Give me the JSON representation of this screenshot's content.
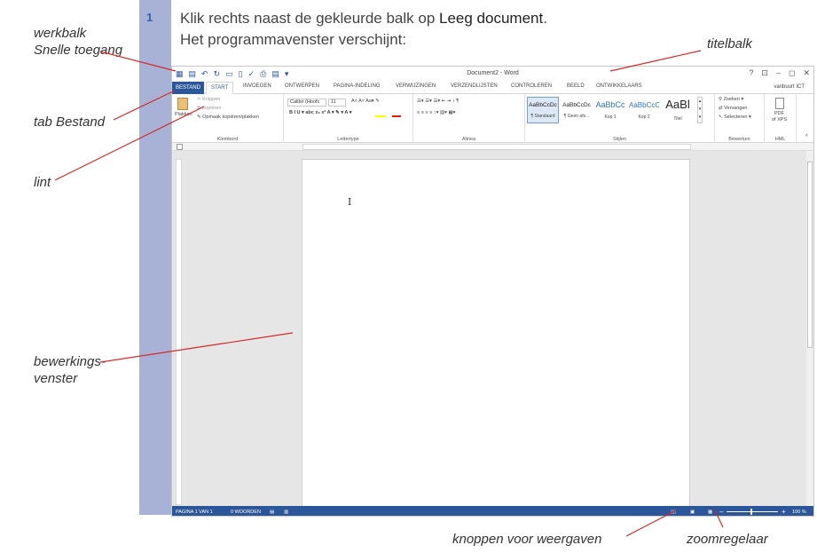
{
  "step_number": "1",
  "instruction": {
    "line1_prefix": "Klik rechts naast de gekleurde balk op ",
    "line1_bold": "Leeg document",
    "line1_suffix": ".",
    "line2": "Het programmavenster verschijnt:"
  },
  "callouts": {
    "qat_line1": "werkbalk",
    "qat_line2": "Snelle toegang",
    "file_tab": "tab Bestand",
    "ribbon": "lint",
    "editing_line1": "bewerkings-",
    "editing_line2": "venster",
    "title_bar": "titelbalk",
    "view_buttons": "knoppen voor weergaven",
    "zoom_slider": "zoomregelaar"
  },
  "word": {
    "title": "Document2 - Word",
    "window_controls": [
      "?",
      "⊡",
      "–",
      "◻",
      "✕"
    ],
    "user": "vanbuurt ICT",
    "tabs": [
      "BESTAND",
      "START",
      "INVOEGEN",
      "ONTWERPEN",
      "PAGINA-INDELING",
      "VERWIJZINGEN",
      "VERZENDLIJSTEN",
      "CONTROLEREN",
      "BEELD",
      "ONTWIKKELAARS"
    ],
    "clipboard": {
      "paste": "Plakken",
      "cut": "Knippen",
      "copy": "Kopiëren",
      "format_painter": "Opmaak kopiëren/plakken",
      "group": "Klembord"
    },
    "font": {
      "name": "Calibri (Hoofc",
      "size": "11",
      "group": "Lettertype"
    },
    "paragraph": {
      "group": "Alinea"
    },
    "styles": {
      "items": [
        {
          "preview": "AaBbCcDc",
          "name": "¶ Standaard"
        },
        {
          "preview": "AaBbCcDc",
          "name": "¶ Geen afs..."
        },
        {
          "preview": "AaBbCc",
          "name": "Kop 1"
        },
        {
          "preview": "AaBbCcC",
          "name": "Kop 2"
        },
        {
          "preview": "AaBl",
          "name": "Titel"
        }
      ],
      "group": "Stijlen"
    },
    "editing": {
      "find": "Zoeken",
      "replace": "Vervangen",
      "select": "Selecteren",
      "group": "Bewerken"
    },
    "pdf": {
      "label1": "PDF",
      "label2": "of XPS",
      "group": "HML"
    },
    "status": {
      "page": "PAGINA 1 VAN 1",
      "words": "0 WOORDEN",
      "zoom": "100 %"
    }
  }
}
